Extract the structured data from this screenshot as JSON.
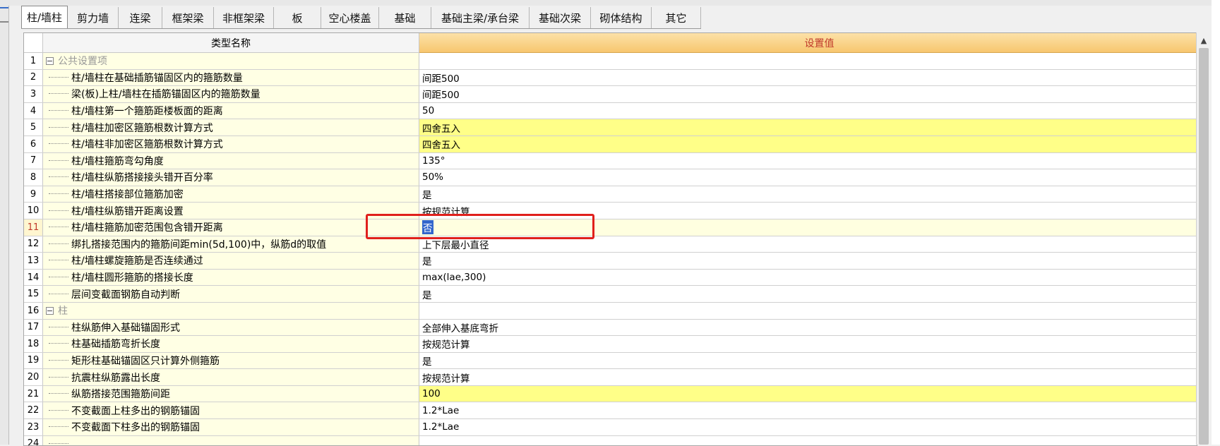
{
  "tabs": [
    {
      "label": "柱/墙柱",
      "width": 66,
      "active": true
    },
    {
      "label": "剪力墙",
      "width": 72
    },
    {
      "label": "连梁",
      "width": 62
    },
    {
      "label": "框架梁",
      "width": 73
    },
    {
      "label": "非框架梁",
      "width": 85
    },
    {
      "label": "板",
      "width": 67
    },
    {
      "label": "空心楼盖",
      "width": 82
    },
    {
      "label": "基础",
      "width": 74
    },
    {
      "label": "基础主梁/承台梁",
      "width": 139
    },
    {
      "label": "基础次梁",
      "width": 87
    },
    {
      "label": "砌体结构",
      "width": 86
    },
    {
      "label": "其它",
      "width": 70
    }
  ],
  "grid": {
    "header_name": "类型名称",
    "header_value": "设置值",
    "rows": [
      {
        "num": "1",
        "name": "公共设置项",
        "value": "",
        "group": true
      },
      {
        "num": "2",
        "name": "柱/墙柱在基础插筋锚固区内的箍筋数量",
        "value": "间距500"
      },
      {
        "num": "3",
        "name": "梁(板)上柱/墙柱在插筋锚固区内的箍筋数量",
        "value": "间距500"
      },
      {
        "num": "4",
        "name": "柱/墙柱第一个箍筋距楼板面的距离",
        "value": "50"
      },
      {
        "num": "5",
        "name": "柱/墙柱加密区箍筋根数计算方式",
        "value": "四舍五入",
        "hl": true
      },
      {
        "num": "6",
        "name": "柱/墙柱非加密区箍筋根数计算方式",
        "value": "四舍五入",
        "hl": true
      },
      {
        "num": "7",
        "name": "柱/墙柱箍筋弯勾角度",
        "value": "135°"
      },
      {
        "num": "8",
        "name": "柱/墙柱纵筋搭接接头错开百分率",
        "value": "50%"
      },
      {
        "num": "9",
        "name": "柱/墙柱搭接部位箍筋加密",
        "value": "是"
      },
      {
        "num": "10",
        "name": "柱/墙柱纵筋错开距离设置",
        "value": "按规范计算"
      },
      {
        "num": "11",
        "name": "柱/墙柱箍筋加密范围包含错开距离",
        "value": "否",
        "selected": true
      },
      {
        "num": "12",
        "name": "绑扎搭接范围内的箍筋间距min(5d,100)中，纵筋d的取值",
        "value": "上下层最小直径"
      },
      {
        "num": "13",
        "name": "柱/墙柱螺旋箍筋是否连续通过",
        "value": "是"
      },
      {
        "num": "14",
        "name": "柱/墙柱圆形箍筋的搭接长度",
        "value": "max(lae,300)"
      },
      {
        "num": "15",
        "name": "层间变截面钢筋自动判断",
        "value": "是",
        "last": true
      },
      {
        "num": "16",
        "name": "柱",
        "value": "",
        "group": true
      },
      {
        "num": "17",
        "name": "柱纵筋伸入基础锚固形式",
        "value": "全部伸入基底弯折"
      },
      {
        "num": "18",
        "name": "柱基础插筋弯折长度",
        "value": "按规范计算"
      },
      {
        "num": "19",
        "name": "矩形柱基础锚固区只计算外侧箍筋",
        "value": "是"
      },
      {
        "num": "20",
        "name": "抗震柱纵筋露出长度",
        "value": "按规范计算"
      },
      {
        "num": "21",
        "name": "纵筋搭接范围箍筋间距",
        "value": "100",
        "hl": true
      },
      {
        "num": "22",
        "name": "不变截面上柱多出的钢筋锚固",
        "value": "1.2*Lae"
      },
      {
        "num": "23",
        "name": "不变截面下柱多出的钢筋锚固",
        "value": "1.2*Lae"
      },
      {
        "num": "24",
        "name": "",
        "value": ""
      }
    ]
  },
  "colors": {
    "highlight": "#ffff88",
    "header_gradient": "#f7c76f",
    "annotation": "#e0201c"
  }
}
